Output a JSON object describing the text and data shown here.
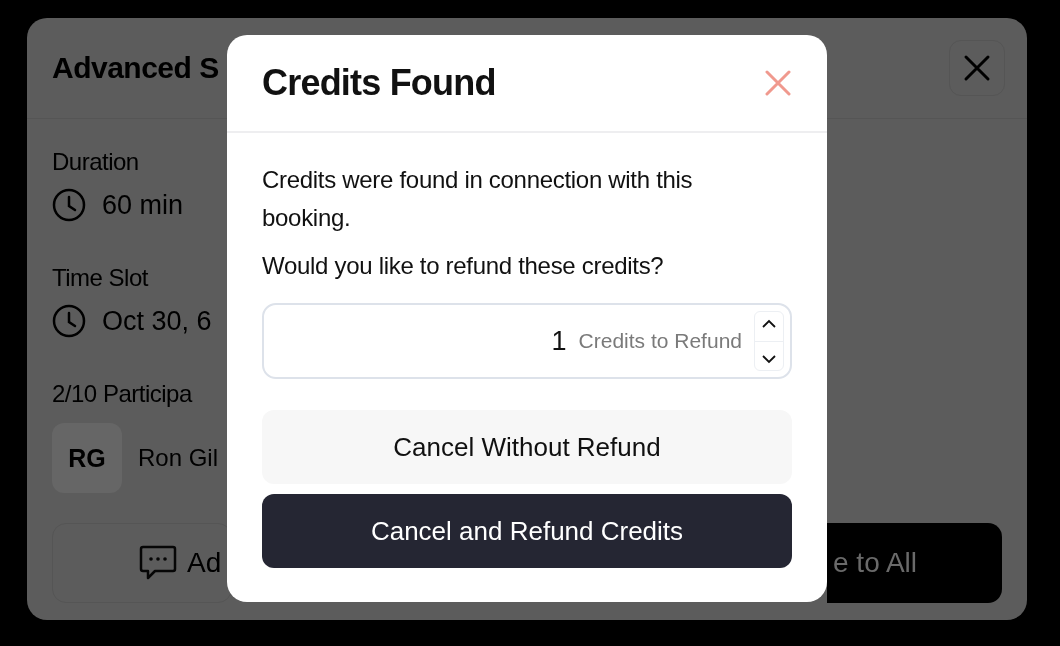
{
  "background_panel": {
    "title": "Advanced S",
    "sections": [
      {
        "label": "Duration",
        "value": "60 min"
      },
      {
        "label": "Time Slot",
        "value": "Oct 30, 6"
      }
    ],
    "participants_heading": "2/10 Participa",
    "participants": [
      {
        "initials": "RG",
        "name": "Ron Gil"
      }
    ],
    "buttons": [
      {
        "label": "Ad",
        "kind": "outline"
      },
      {
        "label": "e to All",
        "kind": "filled"
      }
    ]
  },
  "modal": {
    "title": "Credits Found",
    "message": "Credits were found in connection with this booking.",
    "question": "Would you like to refund these credits?",
    "refund_field": {
      "value": "1",
      "label": "Credits to Refund"
    },
    "buttons": [
      {
        "label": "Cancel Without Refund",
        "kind": "secondary"
      },
      {
        "label": "Cancel and Refund Credits",
        "kind": "primary"
      }
    ]
  }
}
